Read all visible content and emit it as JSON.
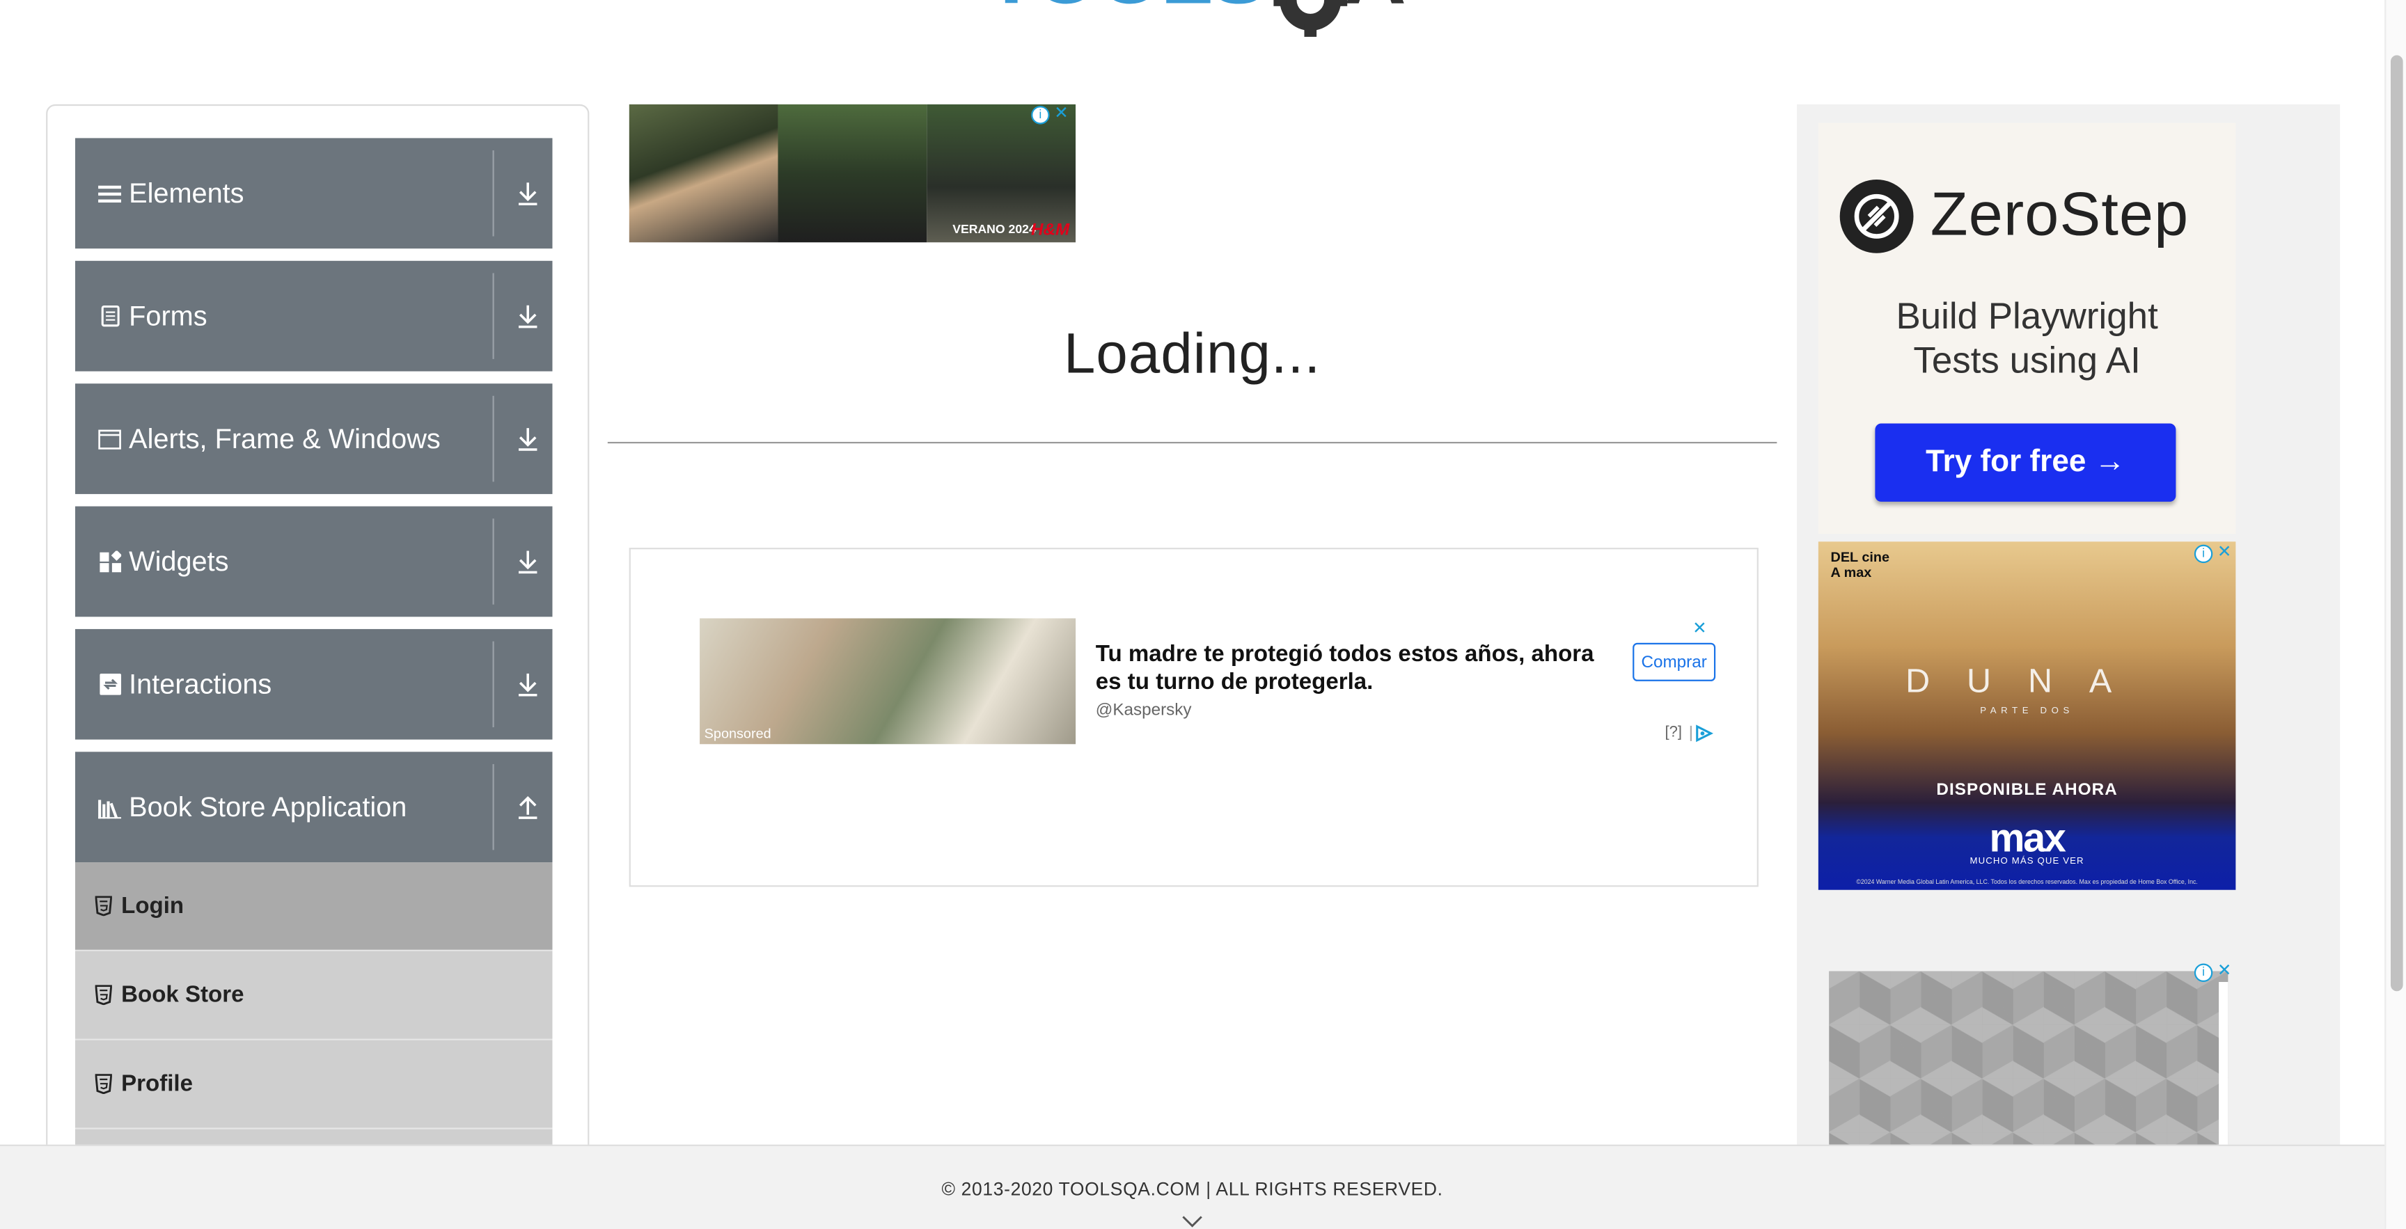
{
  "header": {
    "logo_alt": "ToolsQA"
  },
  "sidebar": {
    "groups": [
      {
        "label": "Elements",
        "icon": "list-icon",
        "state": "collapsed"
      },
      {
        "label": "Forms",
        "icon": "form-icon",
        "state": "collapsed"
      },
      {
        "label": "Alerts, Frame & Windows",
        "icon": "window-icon",
        "state": "collapsed"
      },
      {
        "label": "Widgets",
        "icon": "widgets-icon",
        "state": "collapsed"
      },
      {
        "label": "Interactions",
        "icon": "interactions-icon",
        "state": "collapsed"
      },
      {
        "label": "Book Store Application",
        "icon": "books-icon",
        "state": "expanded"
      }
    ],
    "book_store_items": [
      {
        "label": "Login",
        "active": true
      },
      {
        "label": "Book Store",
        "active": false
      },
      {
        "label": "Profile",
        "active": false
      }
    ]
  },
  "main": {
    "loading_text": "Loading..."
  },
  "ads": {
    "top_banner": {
      "brand": "VERANO 2024",
      "brand_logo": "H&M"
    },
    "middle": {
      "headline": "Tu madre te protegió todos estos años, ahora es tu turno de protegerla.",
      "source": "@Kaspersky",
      "button": "Comprar",
      "sponsored": "Sponsored",
      "help": "[?]"
    },
    "zerostep": {
      "name": "ZeroStep",
      "tagline_1": "Build Playwright",
      "tagline_2": "Tests using AI",
      "cta": "Try for free →"
    },
    "dune": {
      "del_cine": "DEL cine",
      "a_max": "A max",
      "title": "DUNA",
      "subtitle": "PARTE DOS",
      "available": "DISPONIBLE AHORA",
      "max": "max",
      "tagline": "MUCHO MÁS QUE VER",
      "fine_print": "©2024 Warner Media Global Latin America, LLC. Todos los derechos reservados. Max es propiedad de Home Box Office, Inc."
    }
  },
  "footer": {
    "copyright": "© 2013-2020 TOOLSQA.COM | ALL RIGHTS RESERVED."
  },
  "colors": {
    "group_bg": "#6c757d",
    "subitem_bg": "#cfcfcf",
    "subitem_active_bg": "#aaaaaa",
    "zerostep_cta": "#1a2ff0",
    "logo_blue": "#3b9bd6"
  }
}
